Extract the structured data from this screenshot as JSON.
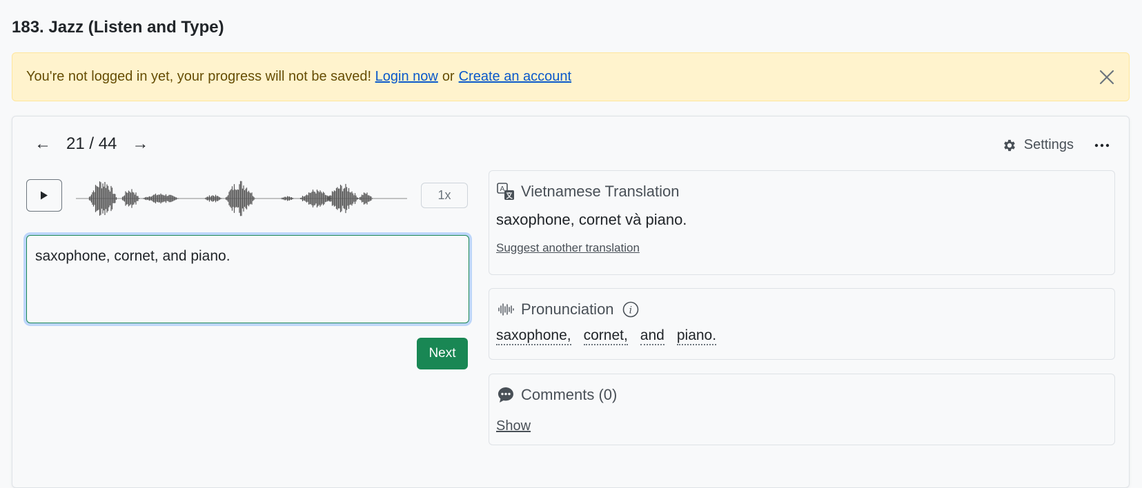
{
  "page": {
    "title": "183. Jazz (Listen and Type)"
  },
  "alert": {
    "message": "You're not logged in yet, your progress will not be saved!",
    "login_label": "Login now",
    "separator": "or",
    "create_label": "Create an account"
  },
  "nav": {
    "prev_icon": "←",
    "counter": "21 / 44",
    "next_icon": "→"
  },
  "toolbar": {
    "settings_label": "Settings",
    "more_icon": "ellipsis-icon"
  },
  "player": {
    "speed_label": "1x"
  },
  "answer": {
    "value": "saxophone, cornet, and piano."
  },
  "next_button": {
    "label": "Next"
  },
  "translation": {
    "heading": "Vietnamese Translation",
    "text": "saxophone, cornet và piano.",
    "suggest_label": "Suggest another translation"
  },
  "pronunciation": {
    "heading": "Pronunciation",
    "words": [
      "saxophone,",
      "cornet,",
      "and",
      "piano."
    ]
  },
  "comments": {
    "heading": "Comments (0)",
    "show_label": "Show"
  },
  "colors": {
    "success": "#198754",
    "alert_bg": "#fff3cd",
    "link": "#0a58ca"
  }
}
